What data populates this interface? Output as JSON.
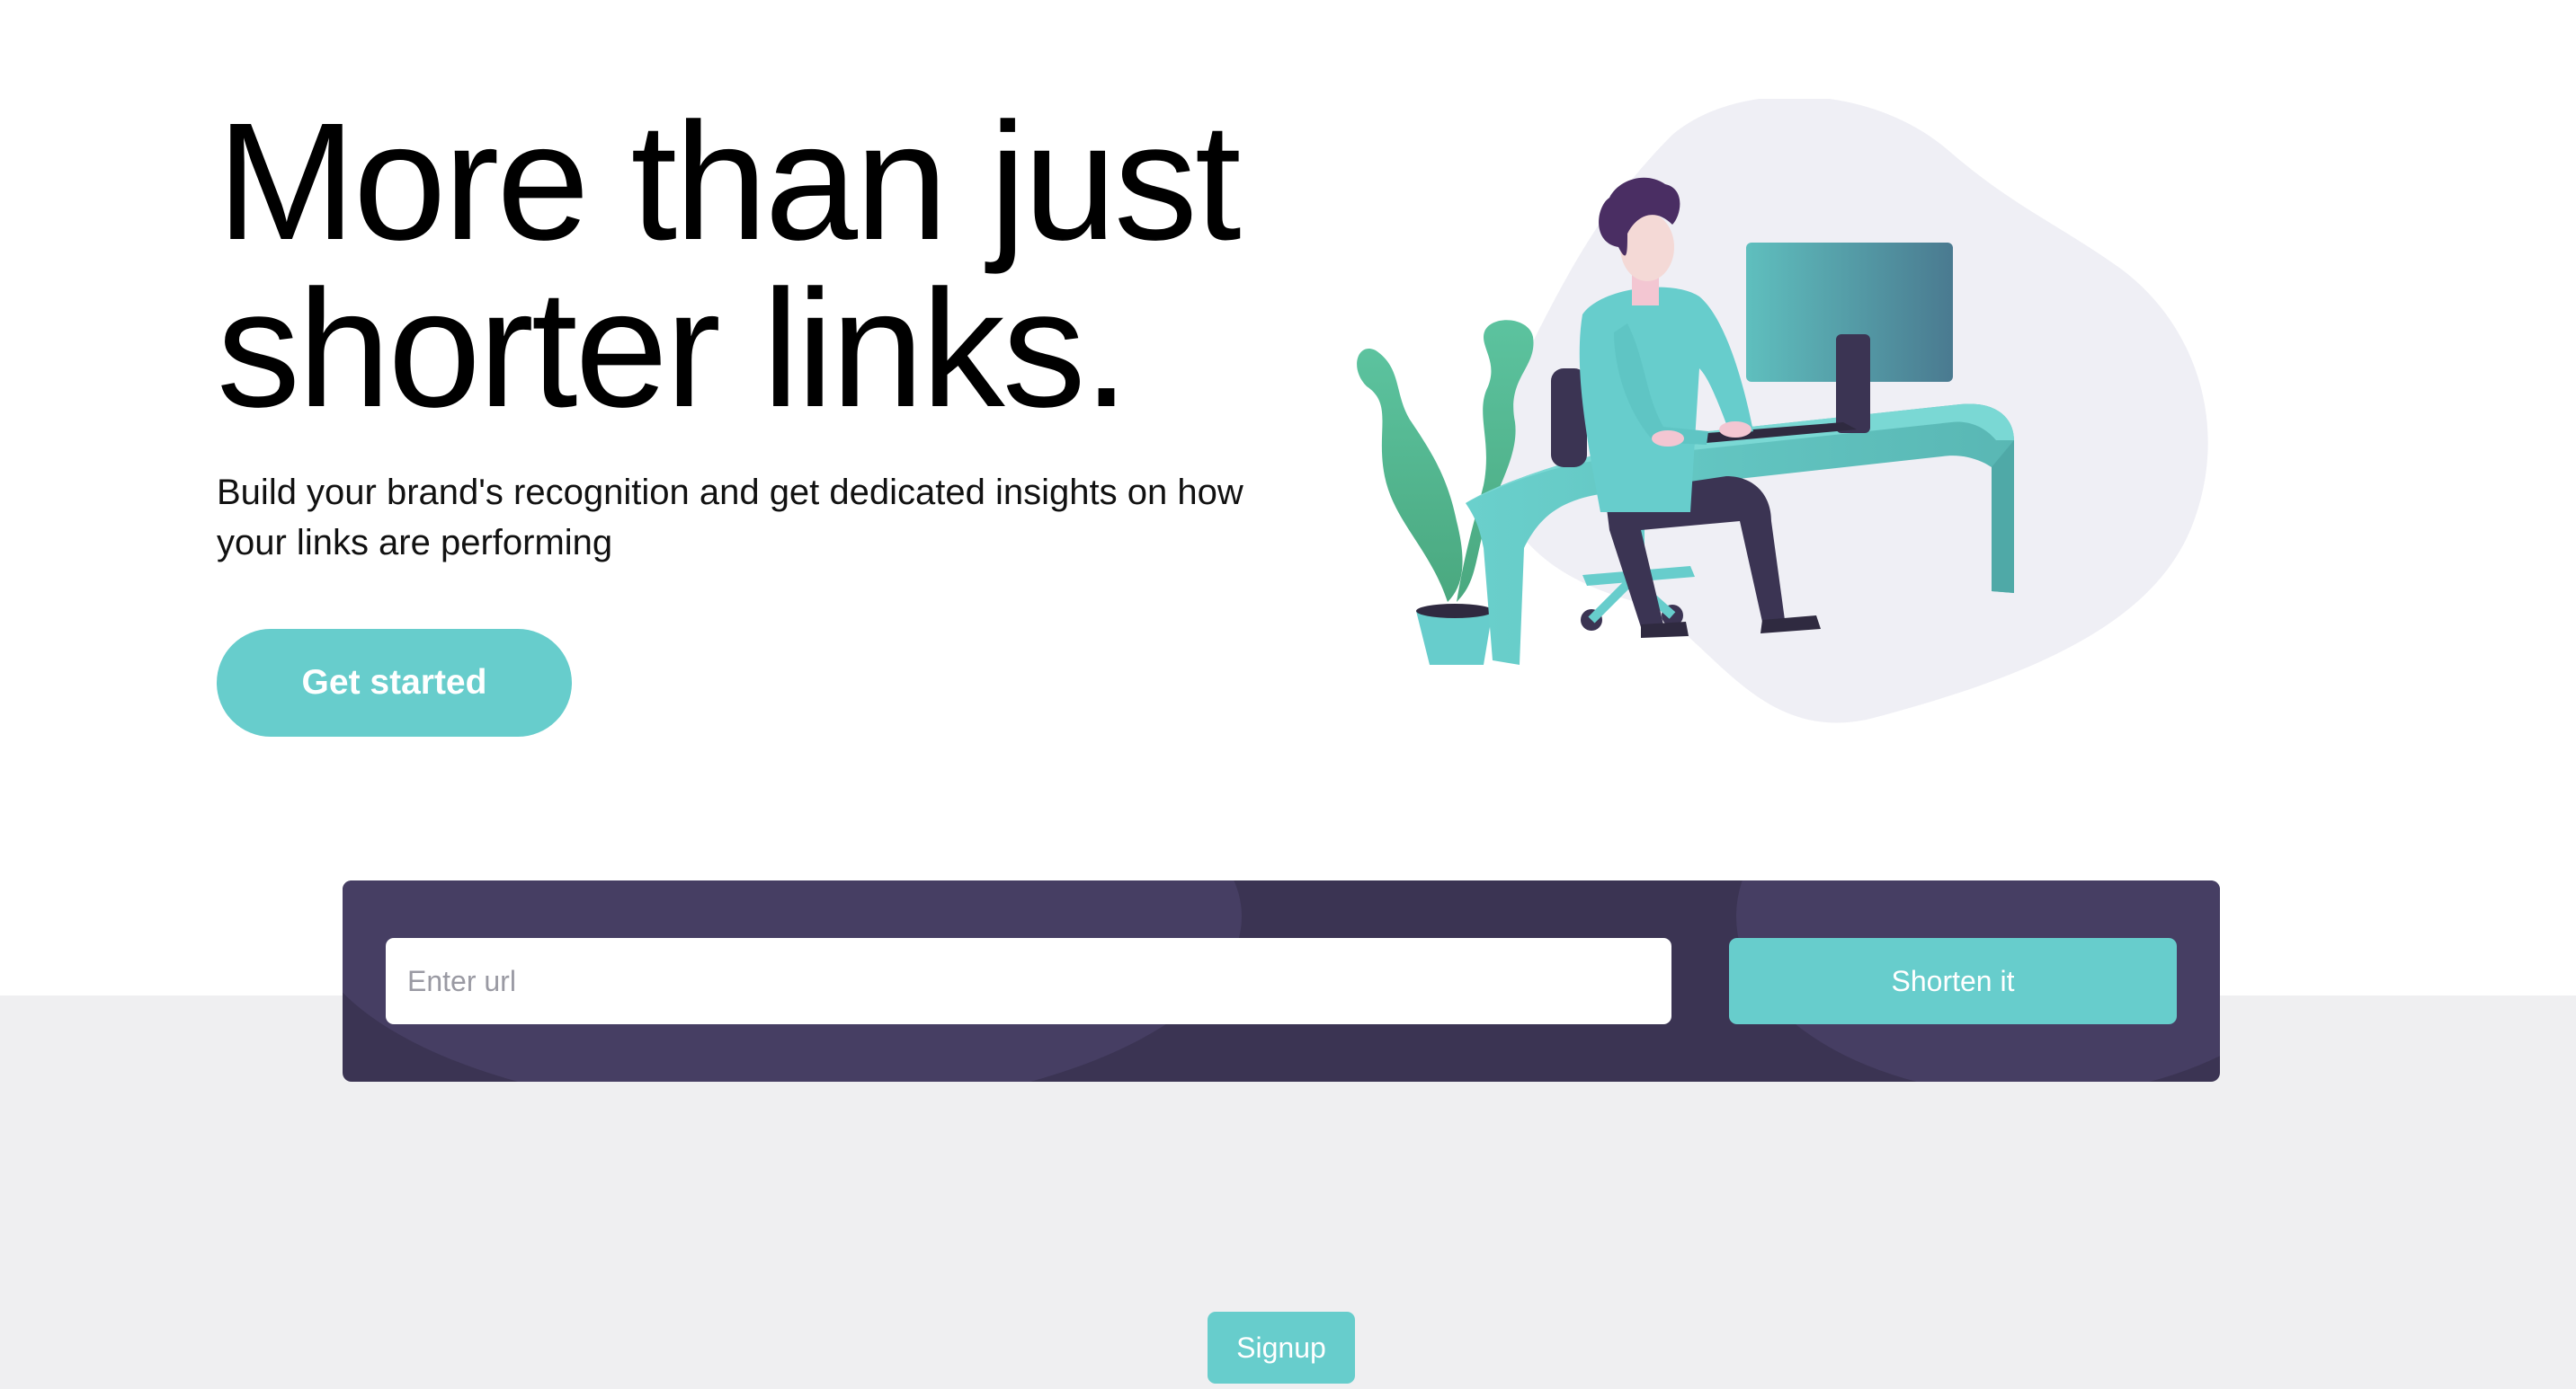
{
  "hero": {
    "title_line1": "More than just",
    "title_line2": "shorter links.",
    "subtitle": "Build your brand's recognition and get dedicated insights on how your links are performing",
    "cta_label": "Get started"
  },
  "illustration": {
    "icon": "person-working-at-desk-illustration"
  },
  "shortener": {
    "input_placeholder": "Enter url",
    "input_value": "",
    "button_label": "Shorten it"
  },
  "footer": {
    "signup_label": "Signup"
  },
  "colors": {
    "accent": "#67cdcc",
    "dark_panel": "#3b3453",
    "band": "#efeff1",
    "blob": "#efeff5"
  }
}
